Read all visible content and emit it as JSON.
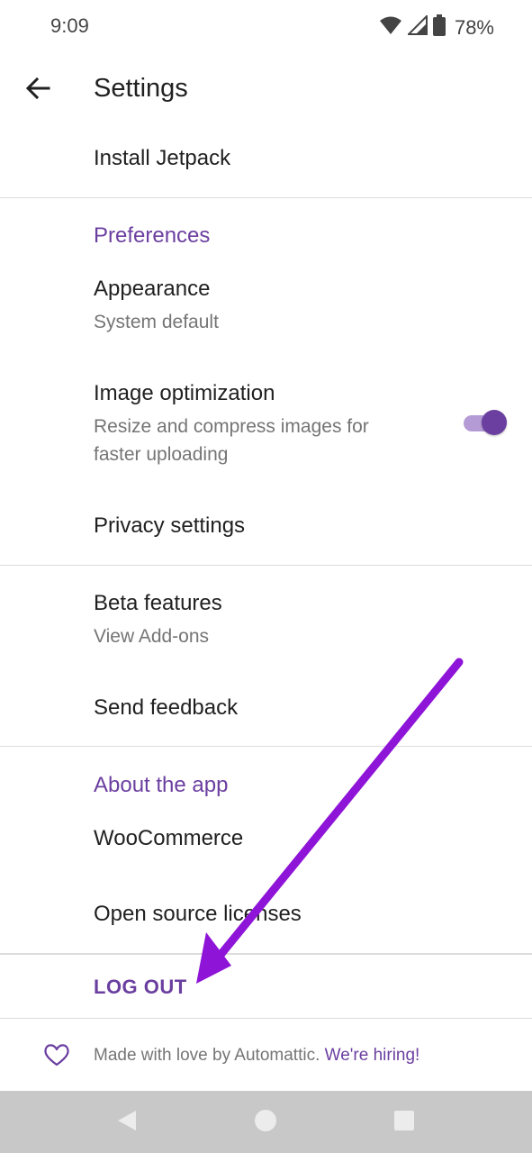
{
  "status_bar": {
    "time": "9:09",
    "battery_percent": "78%",
    "icons": [
      "wifi-icon",
      "cell-signal-icon",
      "battery-icon"
    ]
  },
  "toolbar": {
    "title": "Settings",
    "back_icon": "arrow-left-icon"
  },
  "items": {
    "install_jetpack": "Install Jetpack",
    "preferences_header": "Preferences",
    "appearance_title": "Appearance",
    "appearance_sub": "System default",
    "image_opt_title": "Image optimization",
    "image_opt_sub_line1": "Resize and compress images for",
    "image_opt_sub_line2": "faster uploading",
    "image_opt_enabled": true,
    "privacy": "Privacy settings",
    "beta_title": "Beta features",
    "beta_sub": "View Add-ons",
    "feedback": "Send feedback",
    "about_header": "About the app",
    "woocommerce": "WooCommerce",
    "licenses": "Open source licenses",
    "logout": "LOG OUT"
  },
  "footer": {
    "text": "Made with love by Automattic.",
    "link": "We're hiring!",
    "icon": "heart-icon"
  },
  "colors": {
    "accent": "#6b3fa0",
    "switch_track": "#b59bd6",
    "annotation_arrow": "#8e14d8",
    "nav_bar": "#c8c8c8"
  },
  "nav": {
    "icons": [
      "back-triangle-icon",
      "home-circle-icon",
      "recents-square-icon"
    ]
  }
}
